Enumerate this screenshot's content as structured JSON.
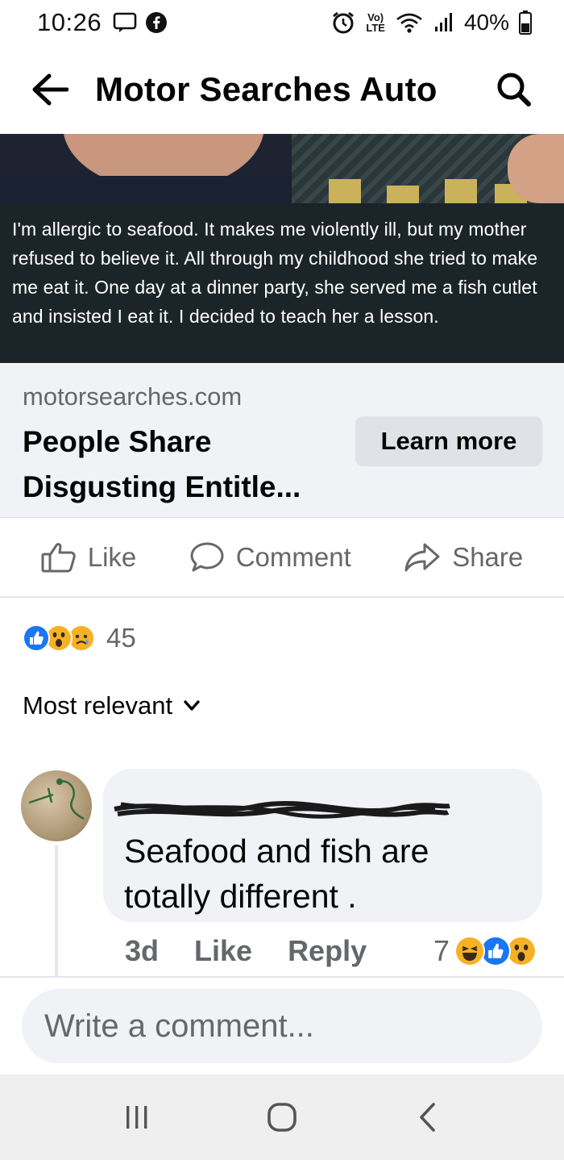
{
  "status_bar": {
    "time": "10:26",
    "battery": "40%",
    "network_label": "Vo) LTE",
    "icons": [
      "message-icon",
      "facebook-icon",
      "alarm-icon",
      "volte-icon",
      "wifi-icon",
      "signal-icon",
      "battery-icon"
    ]
  },
  "header": {
    "title": "Motor Searches Auto",
    "icons": [
      "back-arrow-icon",
      "search-icon"
    ]
  },
  "ad": {
    "caption": "I'm allergic to seafood. It makes me violently ill, but my mother refused to believe it. All through my childhood she tried to make me eat it. One day at a dinner party, she served me a fish cutlet and insisted I eat it. I decided to teach her a lesson.",
    "caption_bg": "#1b2529"
  },
  "link_preview": {
    "domain": "motorsearches.com",
    "title": "People Share Disgusting Entitle...",
    "button_label": "Learn more"
  },
  "actions": {
    "like": "Like",
    "comment": "Comment",
    "share": "Share"
  },
  "reactions": {
    "types": [
      "like",
      "wow",
      "sad"
    ],
    "count": "45"
  },
  "sort": {
    "label": "Most relevant"
  },
  "comment": {
    "text": "Seafood and fish are totally different .",
    "time": "3d",
    "like_label": "Like",
    "reply_label": "Reply",
    "reaction_count": "7",
    "reaction_types": [
      "haha",
      "like",
      "wow"
    ]
  },
  "composer": {
    "placeholder": "Write a comment..."
  },
  "nav_bar": {
    "icons": [
      "recent-apps-icon",
      "home-icon",
      "back-icon"
    ]
  },
  "colors": {
    "facebook_blue": "#1877f2",
    "reaction_yellow": "#f7b125",
    "muted_text": "#65676b",
    "surface_gray": "#f0f2f5"
  }
}
